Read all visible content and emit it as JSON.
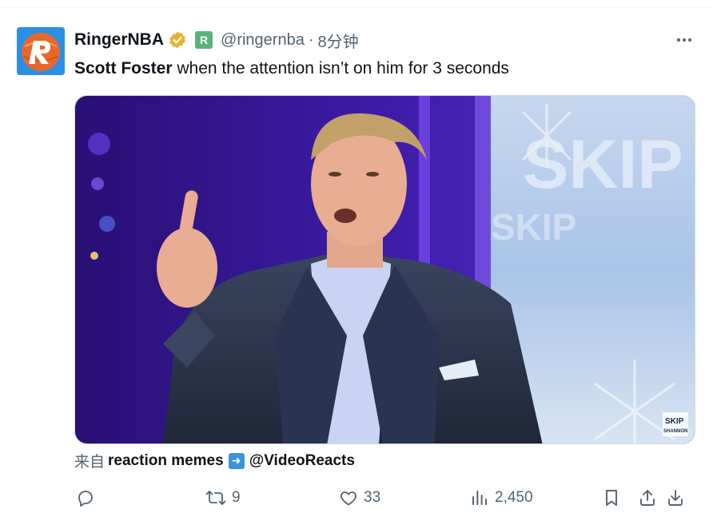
{
  "tweet": {
    "display_name": "RingerNBA",
    "handle": "@ringernba",
    "separator": "·",
    "time": "8分钟",
    "affiliate_badge": "R",
    "text_bold": "Scott Foster",
    "text_rest": " when the attention isn’t on him for 3 seconds",
    "more_icon": "more-horizontal-icon"
  },
  "media": {
    "background_text": "SKIP",
    "watermark_line1": "SKIP",
    "watermark_line2": "SHANNON"
  },
  "attribution": {
    "prefix": "来自",
    "source": "reaction memes",
    "account": "@VideoReacts"
  },
  "actions": {
    "replies": "",
    "retweets": "9",
    "likes": "33",
    "views": "2,450"
  },
  "colors": {
    "secondary_text": "#536471",
    "primary_text": "#0f1419",
    "verified_gold": "#e8b32b",
    "affiliate_green": "#59b37a",
    "avatar_blue": "#2b8fe6",
    "avatar_orange": "#e8682b"
  }
}
